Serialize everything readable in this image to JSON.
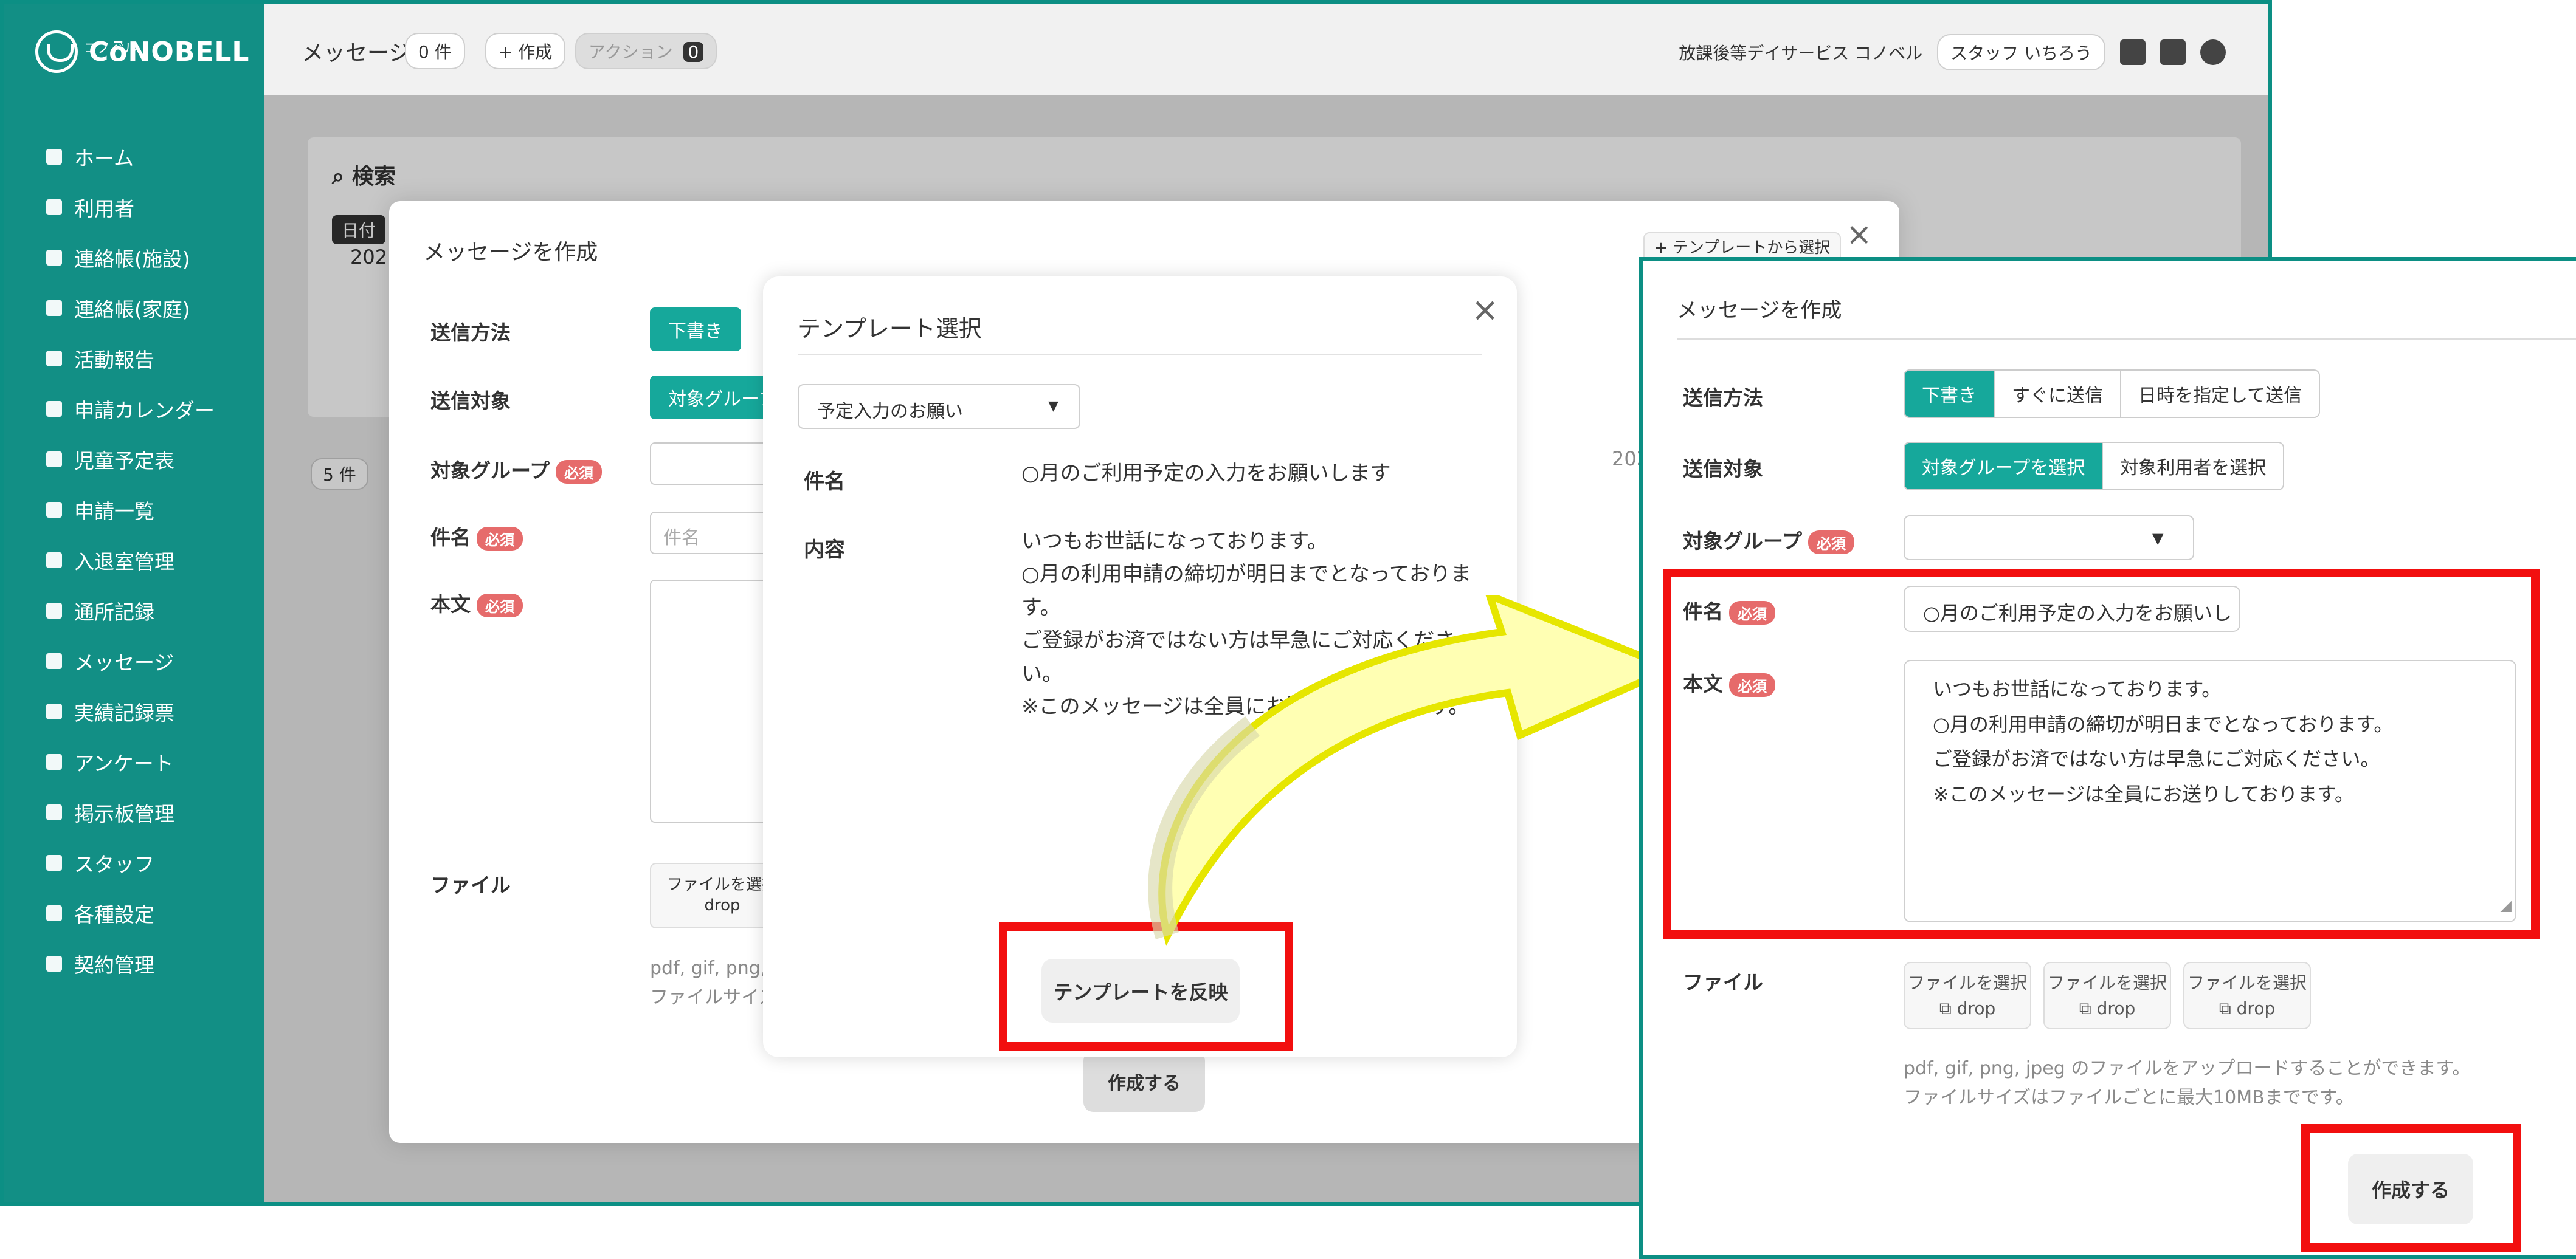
{
  "brand": {
    "logo_text": "CōNOBELL",
    "logo_sub": "コノベル",
    "teal": "#16a89b",
    "red": "#f20f0f"
  },
  "sidebar": {
    "items": [
      {
        "label": "ホーム",
        "icon": "home-icon"
      },
      {
        "label": "利用者",
        "icon": "users-icon"
      },
      {
        "label": "連絡帳(施設)",
        "icon": "notebook-icon"
      },
      {
        "label": "連絡帳(家庭)",
        "icon": "notebook-icon"
      },
      {
        "label": "活動報告",
        "icon": "report-icon"
      },
      {
        "label": "申請カレンダー",
        "icon": "calendar-icon"
      },
      {
        "label": "児童予定表",
        "icon": "bus-icon"
      },
      {
        "label": "申請一覧",
        "icon": "list-icon"
      },
      {
        "label": "入退室管理",
        "icon": "door-icon"
      },
      {
        "label": "通所記録",
        "icon": "record-icon"
      },
      {
        "label": "メッセージ",
        "icon": "bell-icon"
      },
      {
        "label": "実績記録票",
        "icon": "table-icon"
      },
      {
        "label": "アンケート",
        "icon": "pie-icon"
      },
      {
        "label": "掲示板管理",
        "icon": "board-icon"
      },
      {
        "label": "スタッフ",
        "icon": "staff-icon"
      },
      {
        "label": "各種設定",
        "icon": "gear-icon"
      },
      {
        "label": "契約管理",
        "icon": "contract-icon"
      }
    ]
  },
  "header": {
    "title": "メッセージ",
    "count": "0 件",
    "create": "+ 作成",
    "action": "アクション",
    "action_count": "0",
    "facility": "放課後等デイサービス コノベル",
    "user": "スタッフ いちろう"
  },
  "search": {
    "title": "検索",
    "date": "日付",
    "date_value": "202",
    "count_label": "5 件"
  },
  "bg_modal": {
    "title": "メッセージを作成",
    "template_button": "+ テンプレートから選択",
    "send_method_label": "送信方法",
    "send_method_selected": "下書き",
    "target_label": "送信対象",
    "target_selected": "対象グループ",
    "group_label": "対象グループ",
    "required": "必須",
    "subject_label": "件名",
    "subject_placeholder": "件名",
    "body_label": "本文",
    "file_label": "ファイル",
    "file_button": "ファイルを選択",
    "file_drop": "drop",
    "file_note": "pdf, gif, png,",
    "file_size_note": "ファイルサイズは",
    "create_button": "作成する",
    "date_hint": "202"
  },
  "template_modal": {
    "title": "テンプレート選択",
    "select_value": "予定入力のお願い",
    "subject_label": "件名",
    "subject_value": "○月のご利用予定の入力をお願いします",
    "content_label": "内容",
    "content_lines": [
      "いつもお世話になっております。",
      "○月の利用申請の締切が明日までとなっておりま",
      "す。",
      "ご登録がお済ではない方は早急にご対応くださ",
      "い。",
      "※このメッセージは全員にお送りしております。"
    ],
    "apply_button": "テンプレートを反映"
  },
  "zoom_modal": {
    "title": "メッセージを作成",
    "send_method_label": "送信方法",
    "send_methods": [
      "下書き",
      "すぐに送信",
      "日時を指定して送信"
    ],
    "target_label": "送信対象",
    "targets": [
      "対象グループを選択",
      "対象利用者を選択"
    ],
    "group_label": "対象グループ",
    "required": "必須",
    "subject_label": "件名",
    "subject_value": "○月のご利用予定の入力をお願いし",
    "body_label": "本文",
    "body_lines": [
      "いつもお世話になっております。",
      "○月の利用申請の締切が明日までとなっております。",
      "ご登録がお済ではない方は早急にご対応ください。",
      "※このメッセージは全員にお送りしております。"
    ],
    "file_label": "ファイル",
    "file_button": "ファイルを選択",
    "file_drop": "drop",
    "file_note_1": "pdf, gif, png, jpeg のファイルをアップロードすることができます。",
    "file_note_2": "ファイルサイズはファイルごとに最大10MBまでです。",
    "create_button": "作成する"
  }
}
